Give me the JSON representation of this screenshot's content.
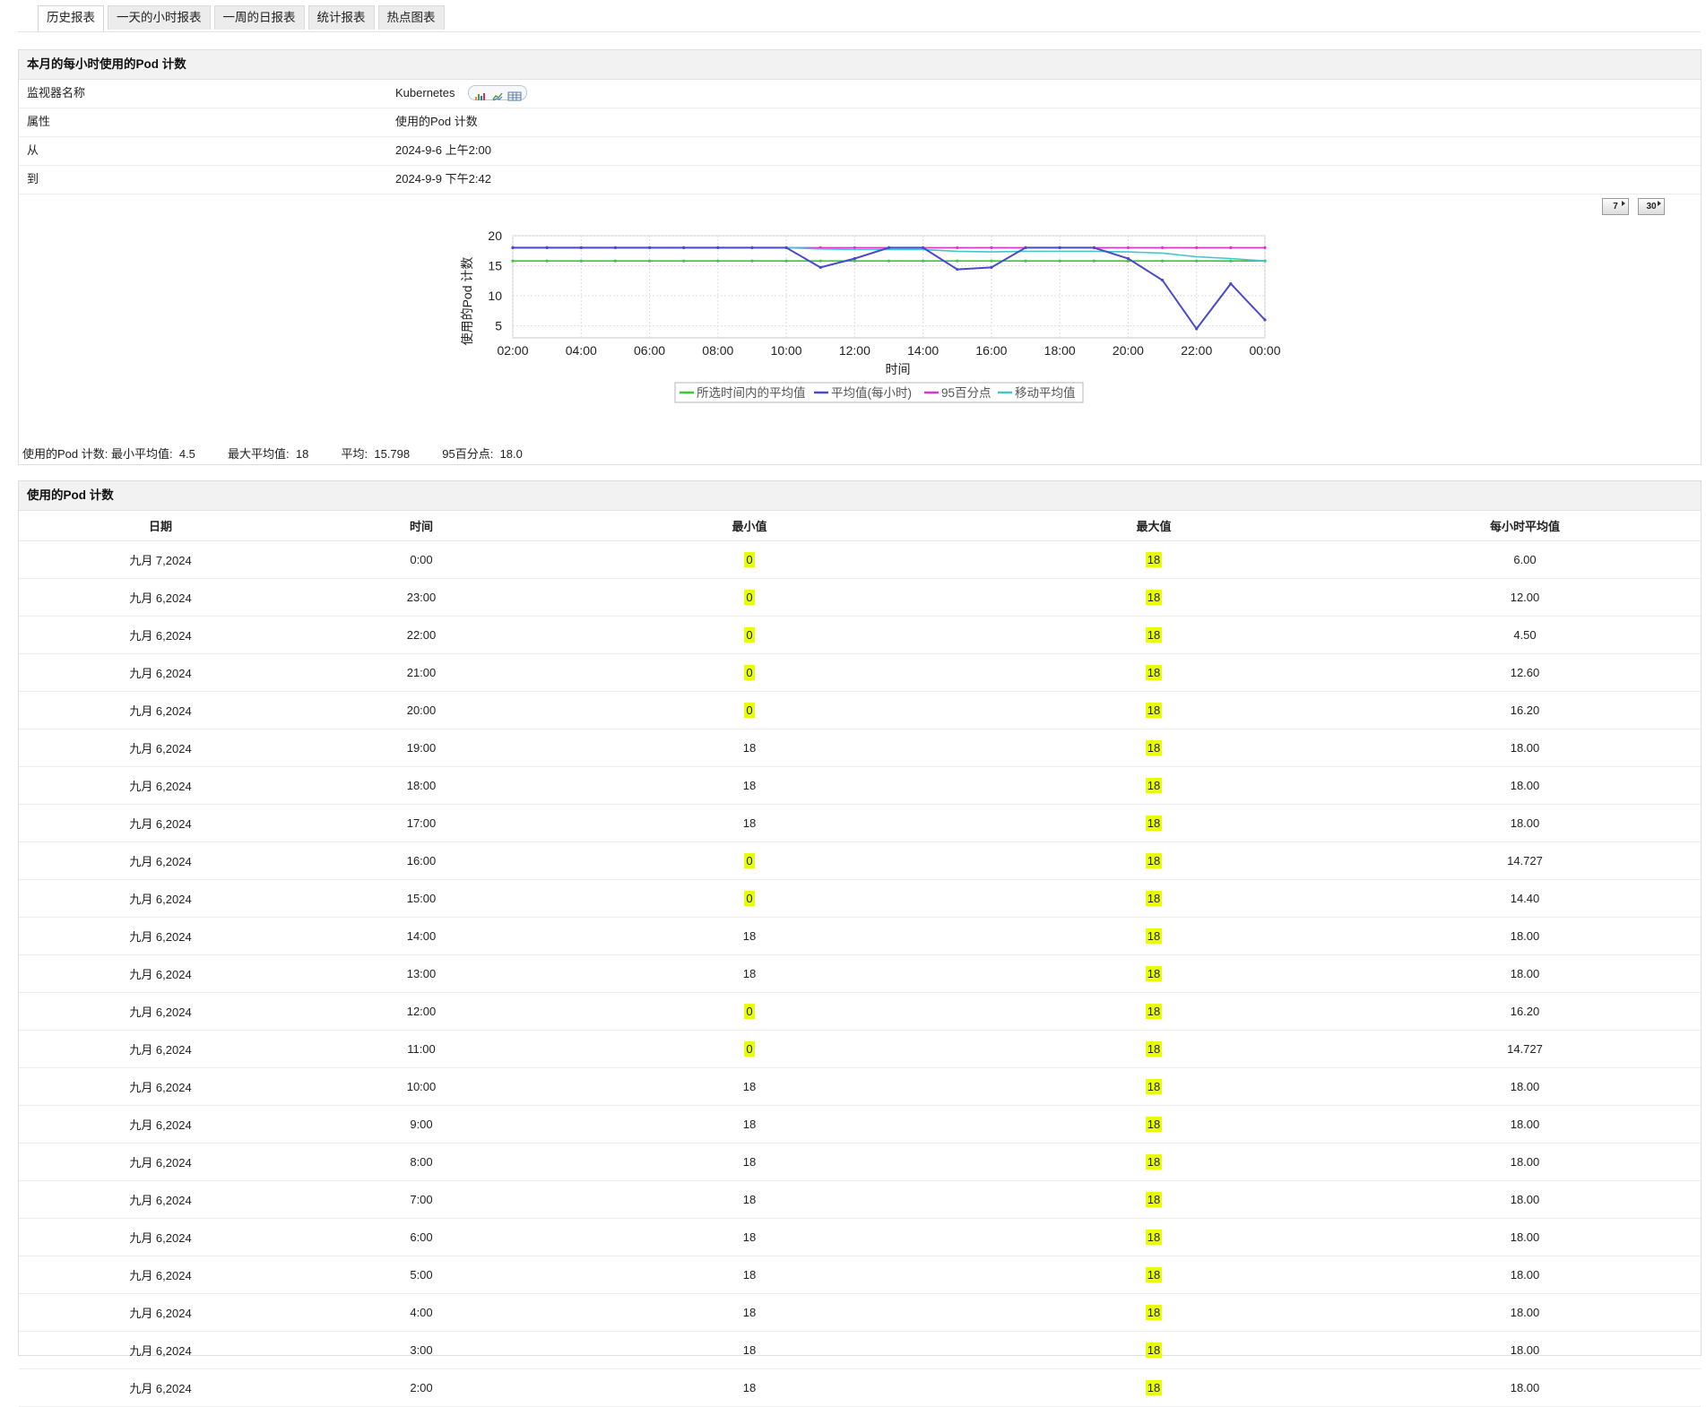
{
  "tabs": [
    {
      "label": "历史报表",
      "active": true
    },
    {
      "label": "一天的小时报表",
      "active": false
    },
    {
      "label": "一周的日报表",
      "active": false
    },
    {
      "label": "统计报表",
      "active": false
    },
    {
      "label": "热点图表",
      "active": false
    }
  ],
  "summary": {
    "title": "本月的每小时使用的Pod 计数",
    "rows": [
      {
        "key": "监视器名称",
        "value": "Kubernetes"
      },
      {
        "key": "属性",
        "value": "使用的Pod 计数"
      },
      {
        "key": "从",
        "value": "2024-9-6 上午2:00"
      },
      {
        "key": "到",
        "value": "2024-9-9 下午2:42"
      }
    ],
    "range_buttons": [
      "7",
      "30"
    ],
    "stats": {
      "label": "使用的Pod 计数:",
      "min_label": "最小平均值:",
      "min_value": "4.5",
      "max_label": "最大平均值:",
      "max_value": "18",
      "avg_label": "平均:",
      "avg_value": "15.798",
      "p95_label": "95百分点:",
      "p95_value": "18.0"
    }
  },
  "chart_data": {
    "type": "line",
    "xlabel": "时间",
    "ylabel": "使用的Pod 计数",
    "ylim": [
      3,
      20
    ],
    "yticks": [
      5,
      10,
      15,
      20
    ],
    "xticks": [
      "02:00",
      "04:00",
      "06:00",
      "08:00",
      "10:00",
      "12:00",
      "14:00",
      "16:00",
      "18:00",
      "20:00",
      "22:00",
      "00:00"
    ],
    "x_hours": [
      2,
      3,
      4,
      5,
      6,
      7,
      8,
      9,
      10,
      11,
      12,
      13,
      14,
      15,
      16,
      17,
      18,
      19,
      20,
      21,
      22,
      23,
      24
    ],
    "grid": true,
    "legend_position": "bottom",
    "series": [
      {
        "name": "所选时间内的平均值",
        "color": "#33cc33",
        "values": [
          15.798,
          15.798,
          15.798,
          15.798,
          15.798,
          15.798,
          15.798,
          15.798,
          15.798,
          15.798,
          15.798,
          15.798,
          15.798,
          15.798,
          15.798,
          15.798,
          15.798,
          15.798,
          15.798,
          15.798,
          15.798,
          15.798,
          15.798
        ]
      },
      {
        "name": "平均值(每小时)",
        "color": "#4a4acc",
        "values": [
          18,
          18,
          18,
          18,
          18,
          18,
          18,
          18,
          18,
          14.727,
          16.2,
          18,
          18,
          14.4,
          14.727,
          18,
          18,
          18,
          16.2,
          12.6,
          4.5,
          12,
          6
        ]
      },
      {
        "name": "95百分点",
        "color": "#dd33cc",
        "values": [
          18,
          18,
          18,
          18,
          18,
          18,
          18,
          18,
          18,
          18,
          18,
          18,
          18,
          18,
          18,
          18,
          18,
          18,
          18,
          18,
          18,
          18,
          18
        ]
      },
      {
        "name": "移动平均值",
        "color": "#44c4cc",
        "values": [
          18,
          18,
          18,
          18,
          18,
          18,
          18,
          18,
          18,
          17.8,
          17.7,
          17.7,
          17.7,
          17.4,
          17.3,
          17.4,
          17.4,
          17.4,
          17.3,
          17.1,
          16.5,
          16.2,
          15.8
        ]
      }
    ]
  },
  "table": {
    "title": "使用的Pod 计数",
    "columns": [
      "日期",
      "时间",
      "最小值",
      "最大值",
      "每小时平均值"
    ],
    "rows": [
      [
        "九月 7,2024",
        "0:00",
        "0",
        "18",
        "6.00"
      ],
      [
        "九月 6,2024",
        "23:00",
        "0",
        "18",
        "12.00"
      ],
      [
        "九月 6,2024",
        "22:00",
        "0",
        "18",
        "4.50"
      ],
      [
        "九月 6,2024",
        "21:00",
        "0",
        "18",
        "12.60"
      ],
      [
        "九月 6,2024",
        "20:00",
        "0",
        "18",
        "16.20"
      ],
      [
        "九月 6,2024",
        "19:00",
        "18",
        "18",
        "18.00"
      ],
      [
        "九月 6,2024",
        "18:00",
        "18",
        "18",
        "18.00"
      ],
      [
        "九月 6,2024",
        "17:00",
        "18",
        "18",
        "18.00"
      ],
      [
        "九月 6,2024",
        "16:00",
        "0",
        "18",
        "14.727"
      ],
      [
        "九月 6,2024",
        "15:00",
        "0",
        "18",
        "14.40"
      ],
      [
        "九月 6,2024",
        "14:00",
        "18",
        "18",
        "18.00"
      ],
      [
        "九月 6,2024",
        "13:00",
        "18",
        "18",
        "18.00"
      ],
      [
        "九月 6,2024",
        "12:00",
        "0",
        "18",
        "16.20"
      ],
      [
        "九月 6,2024",
        "11:00",
        "0",
        "18",
        "14.727"
      ],
      [
        "九月 6,2024",
        "10:00",
        "18",
        "18",
        "18.00"
      ],
      [
        "九月 6,2024",
        "9:00",
        "18",
        "18",
        "18.00"
      ],
      [
        "九月 6,2024",
        "8:00",
        "18",
        "18",
        "18.00"
      ],
      [
        "九月 6,2024",
        "7:00",
        "18",
        "18",
        "18.00"
      ],
      [
        "九月 6,2024",
        "6:00",
        "18",
        "18",
        "18.00"
      ],
      [
        "九月 6,2024",
        "5:00",
        "18",
        "18",
        "18.00"
      ],
      [
        "九月 6,2024",
        "4:00",
        "18",
        "18",
        "18.00"
      ],
      [
        "九月 6,2024",
        "3:00",
        "18",
        "18",
        "18.00"
      ],
      [
        "九月 6,2024",
        "2:00",
        "18",
        "18",
        "18.00"
      ]
    ],
    "highlight_values": {
      "min": "0",
      "max": "18"
    },
    "highlight_color": "#e8ff00"
  }
}
